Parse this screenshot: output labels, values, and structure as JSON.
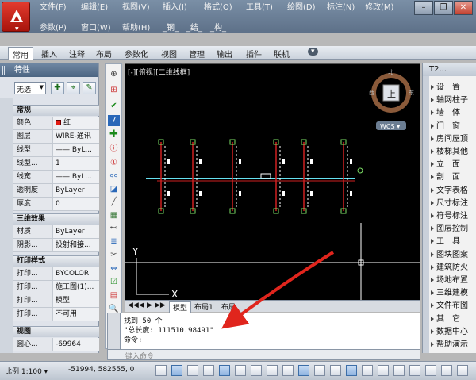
{
  "menu": {
    "row1": [
      "文件(F)",
      "编辑(E)",
      "视图(V)",
      "插入(I)",
      "格式(O)",
      "工具(T)",
      "绘图(D)",
      "标注(N)",
      "修改(M)"
    ],
    "row2": [
      "参数(P)",
      "窗口(W)",
      "帮助(H)",
      "_钢_",
      "_结_",
      "_构_"
    ]
  },
  "ribbon": {
    "tabs": [
      "常用",
      "插入",
      "注释",
      "布局",
      "参数化",
      "视图",
      "管理",
      "输出",
      "插件",
      "联机",
      "▾"
    ]
  },
  "properties": {
    "title": "特性",
    "selection": "无选",
    "sections": {
      "general": "常规",
      "threed": "三维效果",
      "print": "打印样式",
      "view": "视图"
    },
    "general_rows": [
      {
        "k": "颜色",
        "v": "红"
      },
      {
        "k": "图层",
        "v": "WIRE-通讯"
      },
      {
        "k": "线型",
        "v": "—— ByL..."
      },
      {
        "k": "线型...",
        "v": "1"
      },
      {
        "k": "线宽",
        "v": "—— ByL..."
      },
      {
        "k": "透明度",
        "v": "ByLayer"
      },
      {
        "k": "厚度",
        "v": "0"
      }
    ],
    "threed_rows": [
      {
        "k": "材质",
        "v": "ByLayer"
      },
      {
        "k": "阴影...",
        "v": "投射和接..."
      }
    ],
    "print_rows": [
      {
        "k": "打印...",
        "v": "BYCOLOR"
      },
      {
        "k": "打印...",
        "v": "施工图(1)..."
      },
      {
        "k": "打印...",
        "v": "模型"
      },
      {
        "k": "打印...",
        "v": "不可用"
      }
    ],
    "view_rows": [
      {
        "k": "圆心...",
        "v": "-69964"
      }
    ]
  },
  "canvas": {
    "viewport_label": "[-][俯视][二维线框]",
    "viewcube_face": "上",
    "compass": {
      "n": "北",
      "e": "东",
      "w": "西"
    },
    "wcs": "WCS ▾",
    "tabs": [
      "◀◀",
      "◀",
      "▶",
      "▶▶",
      "模型",
      "布局1",
      "布局"
    ],
    "y_axis": "Y",
    "x_axis": "X"
  },
  "command": {
    "lines": [
      "找到 50 个",
      "\"总长度: 111510.98491\"",
      "命令:"
    ],
    "placeholder": "键入命令"
  },
  "palette": {
    "title": "T2...",
    "items": [
      "设　置",
      "轴网柱子",
      "墙　体",
      "门　窗",
      "房间屋顶",
      "楼梯其他",
      "立　面",
      "剖　面",
      "文字表格",
      "尺寸标注",
      "符号标注",
      "图层控制",
      "工　具",
      "图块图案",
      "建筑防火",
      "场地布置",
      "三维建模",
      "文件布图",
      "其　它",
      "数据中心",
      "帮助演示"
    ]
  },
  "status": {
    "scale": "比例 1:100 ▾",
    "coords": "-51994, 582555, 0"
  },
  "colors": {
    "accent_red": "#e23b2e",
    "pipe_cyan": "#66e0f0",
    "drawing_bg": "#000000"
  }
}
